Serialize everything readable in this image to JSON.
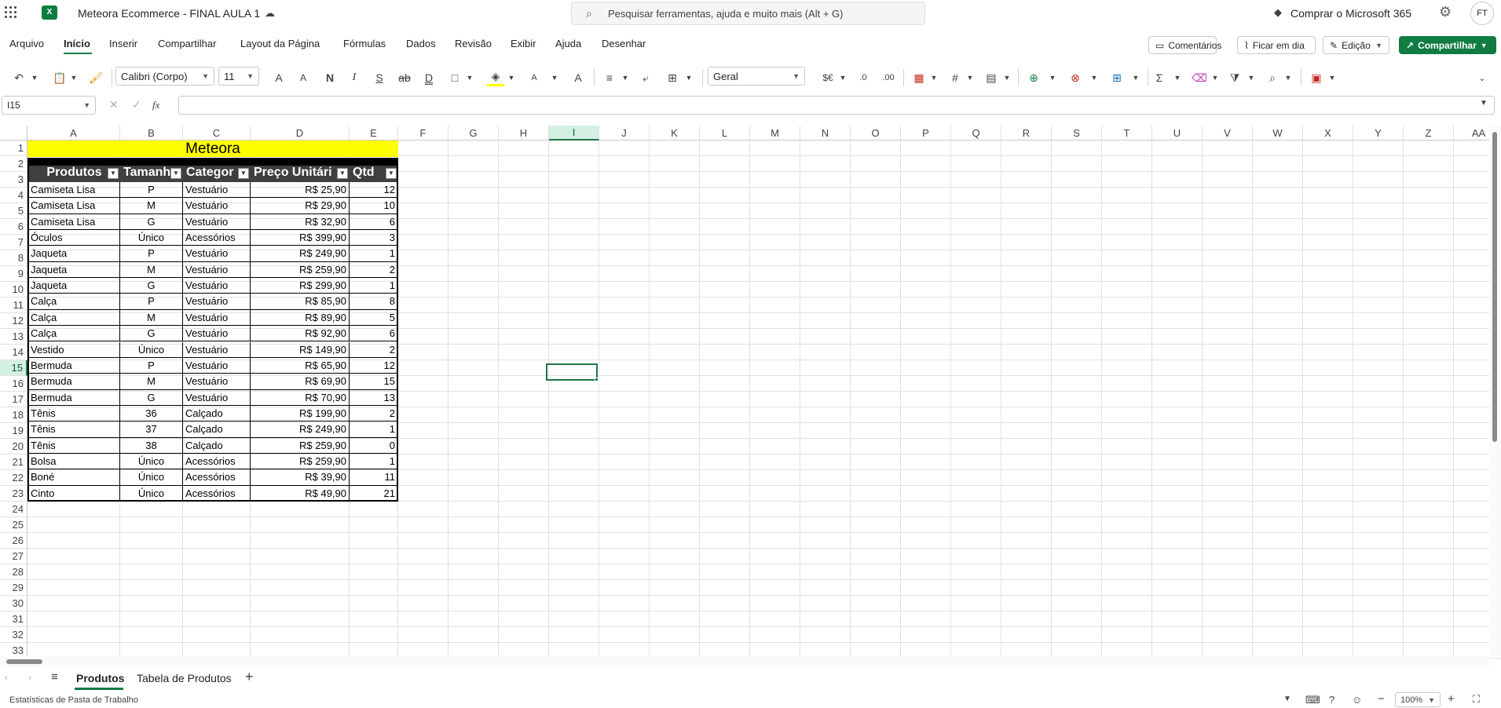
{
  "app": {
    "title": "Meteora Ecommerce - FINAL AULA 1",
    "search_placeholder": "Pesquisar ferramentas, ajuda e muito mais (Alt + G)",
    "buy_label": "Comprar o Microsoft 365",
    "avatar": "FT"
  },
  "menu": [
    "Arquivo",
    "Início",
    "Inserir",
    "Compartilhar",
    "Layout da Página",
    "Fórmulas",
    "Dados",
    "Revisão",
    "Exibir",
    "Ajuda",
    "Desenhar"
  ],
  "menu_active": "Início",
  "right_buttons": {
    "comments": "Comentários",
    "catchup": "Ficar em dia",
    "editing": "Edição",
    "share": "Compartilhar"
  },
  "toolbar": {
    "font": "Calibri (Corpo)",
    "size": "11",
    "number_format": "Geral",
    "bold": "N",
    "italic": "I",
    "underline": "S",
    "strike": "ab",
    "double_underline": "D",
    "font_grow": "A",
    "font_shrink": "A",
    "font_color": "A",
    "superscript": "A",
    "currency": "$€"
  },
  "formula": {
    "cell_ref": "I15",
    "fx": "fx",
    "value": ""
  },
  "columns": [
    "A",
    "B",
    "C",
    "D",
    "E",
    "F",
    "G",
    "H",
    "I",
    "J",
    "K",
    "L",
    "M",
    "N",
    "O",
    "P",
    "Q",
    "R",
    "S",
    "T",
    "U",
    "V",
    "W",
    "X",
    "Y",
    "Z",
    "AA"
  ],
  "rows": [
    "1",
    "2",
    "3",
    "4",
    "5",
    "6",
    "7",
    "8",
    "9",
    "10",
    "11",
    "12",
    "13",
    "14",
    "15",
    "16",
    "17",
    "18",
    "19",
    "20",
    "21",
    "22",
    "23",
    "24",
    "25",
    "26",
    "27",
    "28",
    "29",
    "30",
    "31",
    "32",
    "33"
  ],
  "sheet": {
    "banner": "Meteora",
    "headers": [
      "Produtos",
      "Tamanh",
      "Categor",
      "Preço Unitári",
      "Qtd"
    ],
    "data": [
      [
        "Camiseta Lisa",
        "P",
        "Vestuário",
        "R$ 25,90",
        "12"
      ],
      [
        "Camiseta Lisa",
        "M",
        "Vestuário",
        "R$ 29,90",
        "10"
      ],
      [
        "Camiseta Lisa",
        "G",
        "Vestuário",
        "R$ 32,90",
        "6"
      ],
      [
        "Óculos",
        "Único",
        "Acessórios",
        "R$ 399,90",
        "3"
      ],
      [
        "Jaqueta",
        "P",
        "Vestuário",
        "R$ 249,90",
        "1"
      ],
      [
        "Jaqueta",
        "M",
        "Vestuário",
        "R$ 259,90",
        "2"
      ],
      [
        "Jaqueta",
        "G",
        "Vestuário",
        "R$ 299,90",
        "1"
      ],
      [
        "Calça",
        "P",
        "Vestuário",
        "R$ 85,90",
        "8"
      ],
      [
        "Calça",
        "M",
        "Vestuário",
        "R$ 89,90",
        "5"
      ],
      [
        "Calça",
        "G",
        "Vestuário",
        "R$ 92,90",
        "6"
      ],
      [
        "Vestido",
        "Único",
        "Vestuário",
        "R$ 149,90",
        "2"
      ],
      [
        "Bermuda",
        "P",
        "Vestuário",
        "R$ 65,90",
        "12"
      ],
      [
        "Bermuda",
        "M",
        "Vestuário",
        "R$ 69,90",
        "15"
      ],
      [
        "Bermuda",
        "G",
        "Vestuário",
        "R$ 70,90",
        "13"
      ],
      [
        "Tênis",
        "36",
        "Calçado",
        "R$ 199,90",
        "2"
      ],
      [
        "Tênis",
        "37",
        "Calçado",
        "R$ 249,90",
        "1"
      ],
      [
        "Tênis",
        "38",
        "Calçado",
        "R$ 259,90",
        "0"
      ],
      [
        "Bolsa",
        "Único",
        "Acessórios",
        "R$ 259,90",
        "1"
      ],
      [
        "Boné",
        "Único",
        "Acessórios",
        "R$ 39,90",
        "11"
      ],
      [
        "Cinto",
        "Único",
        "Acessórios",
        "R$ 49,90",
        "21"
      ]
    ]
  },
  "tabs": [
    "Produtos",
    "Tabela de Produtos"
  ],
  "active_tab": "Produtos",
  "status": {
    "left": "Estatísticas de Pasta de Trabalho",
    "zoom": "100%"
  },
  "colors": {
    "excel_green": "#107c41",
    "banner_yellow": "#ffff00",
    "header_dark": "#3f3f3f",
    "selection": "#217346"
  }
}
